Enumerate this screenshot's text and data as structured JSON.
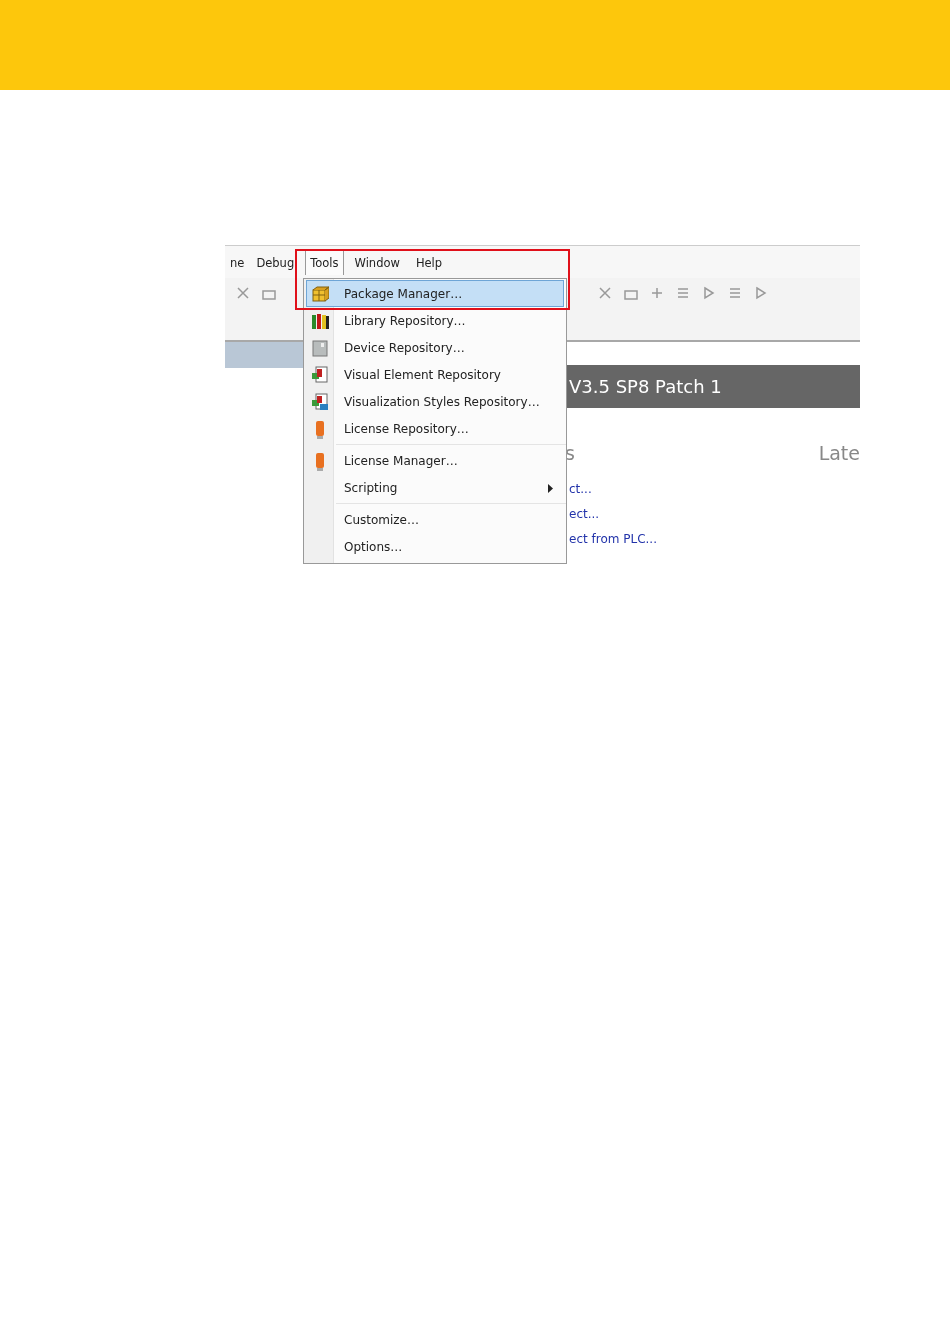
{
  "menubar": [
    {
      "label": "ne",
      "selected": false
    },
    {
      "label": "Debug",
      "selected": false
    },
    {
      "label": "Tools",
      "selected": true
    },
    {
      "label": "Window",
      "selected": false
    },
    {
      "label": "Help",
      "selected": false
    }
  ],
  "menu": {
    "items": [
      {
        "kind": "package",
        "label": "Package Manager…",
        "selected": true,
        "separator_before": false
      },
      {
        "kind": "library",
        "label": "Library Repository…",
        "selected": false,
        "separator_before": false
      },
      {
        "kind": "device",
        "label": "Device Repository…",
        "selected": false,
        "separator_before": false
      },
      {
        "kind": "element",
        "label": "Visual Element Repository",
        "selected": false,
        "separator_before": false
      },
      {
        "kind": "styles",
        "label": "Visualization Styles Repository…",
        "selected": false,
        "separator_before": false
      },
      {
        "kind": "license",
        "label": "License Repository…",
        "selected": false,
        "separator_before": false
      },
      {
        "kind": "license",
        "label": "License Manager…",
        "selected": false,
        "separator_before": true
      },
      {
        "kind": "submenu",
        "label": "Scripting",
        "selected": false,
        "separator_before": false
      },
      {
        "kind": "plain",
        "label": "Customize…",
        "selected": false,
        "separator_before": true
      },
      {
        "kind": "plain",
        "label": "Options…",
        "selected": false,
        "separator_before": false
      }
    ]
  },
  "banner": {
    "title": "V3.5 SP8 Patch 1"
  },
  "headings": [
    "s",
    "Late"
  ],
  "links": [
    "ct...",
    "ect...",
    "ect from PLC..."
  ]
}
